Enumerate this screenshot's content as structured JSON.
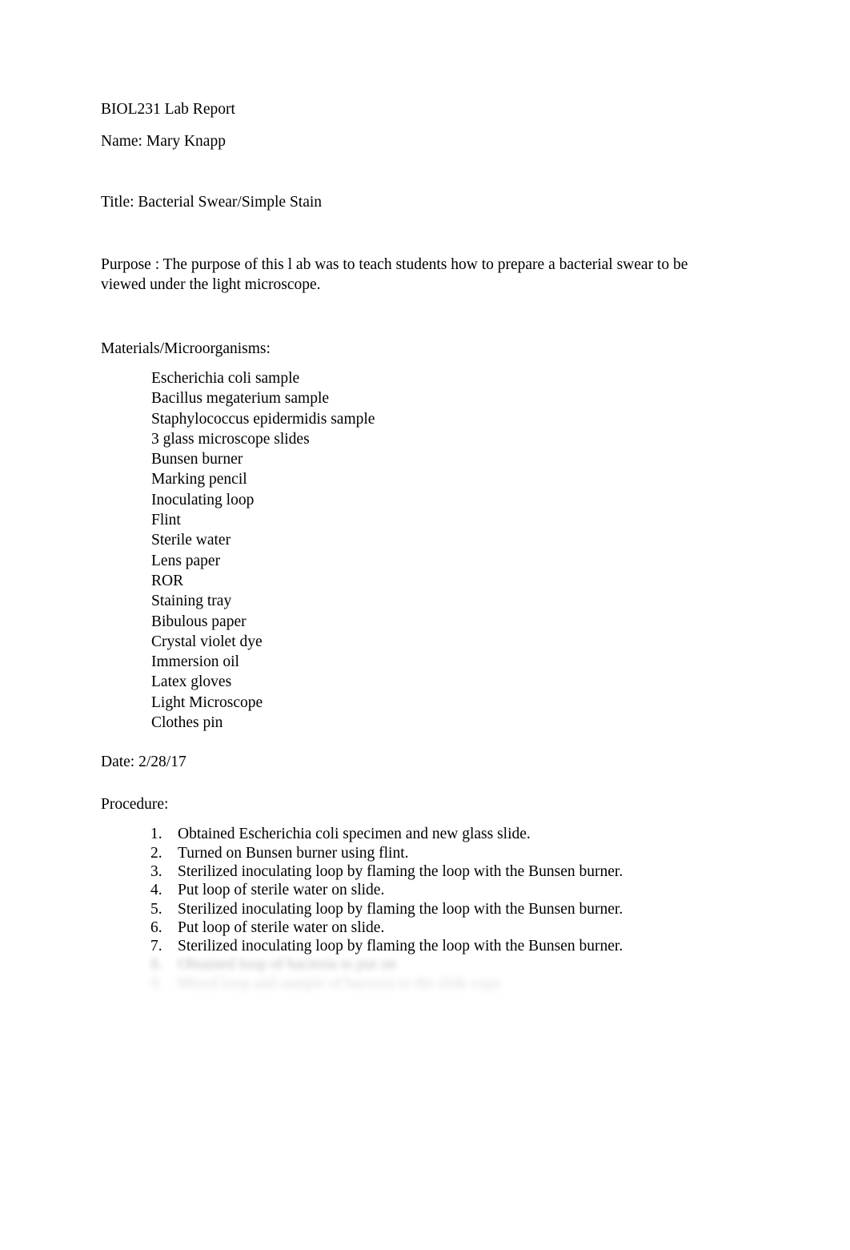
{
  "document": {
    "course_line": "BIOL231 Lab Report",
    "name_line": "Name: Mary Knapp",
    "report_title": "Title: Bacterial Swear/Simple Stain",
    "purpose": "Purpose : The purpose of this l ab was to teach students how to prepare a bacterial swear to be viewed under the light microscope.",
    "materials_heading": "Materials/Microorganisms:",
    "materials": [
      "Escherichia coli sample",
      "Bacillus megaterium sample",
      "Staphylococcus epidermidis sample",
      "3 glass microscope slides",
      "Bunsen burner",
      "Marking pencil",
      "Inoculating loop",
      "Flint",
      "Sterile water",
      "Lens paper",
      "ROR",
      "Staining tray",
      "Bibulous paper",
      "Crystal violet dye",
      "Immersion oil",
      "Latex gloves",
      "Light Microscope",
      "Clothes pin"
    ],
    "date_line": "Date: 2/28/17",
    "procedure_heading": "Procedure:",
    "procedure": [
      {
        "number": "1.",
        "text": "Obtained Escherichia coli specimen and new glass slide."
      },
      {
        "number": "2.",
        "text": "Turned on Bunsen burner using flint."
      },
      {
        "number": "3.",
        "text": "Sterilized inoculating loop by flaming the loop with the Bunsen burner."
      },
      {
        "number": "4.",
        "text": "Put loop of sterile water on slide."
      },
      {
        "number": "5.",
        "text": "Sterilized inoculating loop by flaming the loop with the Bunsen burner."
      },
      {
        "number": "6.",
        "text": "Put loop of sterile water on slide."
      },
      {
        "number": "7.",
        "text": "Sterilized inoculating loop by flaming the loop with the Bunsen burner."
      },
      {
        "number": "8.",
        "text": "Obtained loop of bacteria to put on"
      },
      {
        "number": "9.",
        "text": "Mixed loop and sample of bacteria to the slide copy"
      }
    ]
  }
}
